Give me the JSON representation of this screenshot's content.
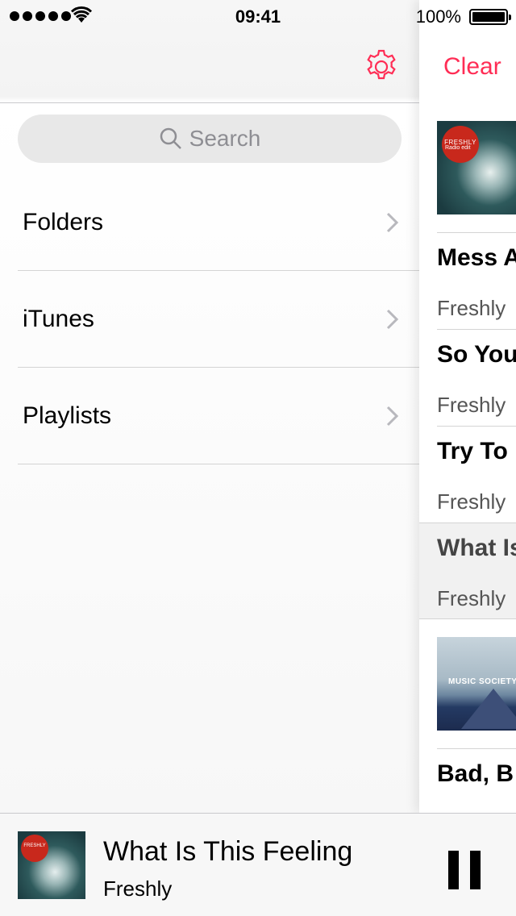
{
  "status_bar": {
    "time": "09:41",
    "battery_percent": "100%",
    "icons": [
      "signal-dots-icon",
      "wifi-icon",
      "battery-icon"
    ]
  },
  "left_pane": {
    "settings_icon": "gear-icon",
    "search": {
      "placeholder": "Search",
      "icon": "search-icon"
    },
    "menu": [
      {
        "label": "Folders",
        "icon": "chevron-right-icon"
      },
      {
        "label": "iTunes",
        "icon": "chevron-right-icon"
      },
      {
        "label": "Playlists",
        "icon": "chevron-right-icon"
      }
    ]
  },
  "right_pane": {
    "clear_label": "Clear",
    "album1_badge": "FRESHLY",
    "album1_subtitle": "Radio edit",
    "tracks": [
      {
        "title": "Mess A",
        "artist": "Freshly"
      },
      {
        "title": "So You",
        "artist": "Freshly"
      },
      {
        "title": "Try To",
        "artist": "Freshly"
      },
      {
        "title": "What Is",
        "artist": "Freshly"
      },
      {
        "title": "Bad, B",
        "artist": ""
      }
    ],
    "album2_title": "MUSIC SOCIETY"
  },
  "now_playing": {
    "title": "What Is This Feeling",
    "artist": "Freshly",
    "album_badge": "FRESHLY",
    "control_icon": "pause-icon"
  },
  "colors": {
    "accent": "#ff2d55",
    "separator": "#d4d4d4"
  }
}
